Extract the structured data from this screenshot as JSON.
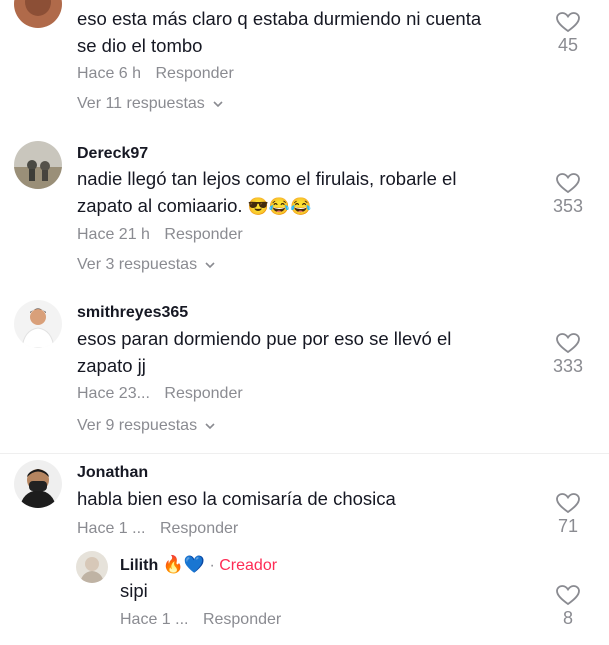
{
  "comments": [
    {
      "username": "",
      "text_lines": [
        "eso esta más claro q estaba durmiendo ni cuenta",
        "se dio el tombo"
      ],
      "time": "Hace 6 h",
      "reply": "Responder",
      "likes": "45",
      "view_replies": "Ver 11 respuestas"
    },
    {
      "username": "Dereck97",
      "text_lines": [
        "nadie llegó tan lejos como el firulais, robarle el",
        "zapato al comiaario."
      ],
      "emojis": "😎😂😂",
      "time": "Hace 21 h",
      "reply": "Responder",
      "likes": "353",
      "view_replies": "Ver 3 respuestas"
    },
    {
      "username": "smithreyes365",
      "text_lines": [
        "esos paran dormiendo pue por eso se llevó el",
        "zapato jj"
      ],
      "time": "Hace 23...",
      "reply": "Responder",
      "likes": "333",
      "view_replies": "Ver 9 respuestas"
    },
    {
      "username": "Jonathan",
      "text_lines": [
        "habla bien eso la comisaría de chosica"
      ],
      "time": "Hace 1 ...",
      "reply": "Responder",
      "likes": "71"
    }
  ],
  "reply": {
    "username": "Lilith",
    "emojis": "🔥💙",
    "separator": "·",
    "badge": "Creador",
    "text": "sipi",
    "time": "Hace 1 ...",
    "reply": "Responder",
    "likes": "8"
  },
  "colors": {
    "accent": "#fe2c55",
    "muted": "#8a8b91",
    "text": "#161823"
  },
  "icons": {
    "like": "heart-outline-icon",
    "expand": "chevron-down-icon"
  }
}
